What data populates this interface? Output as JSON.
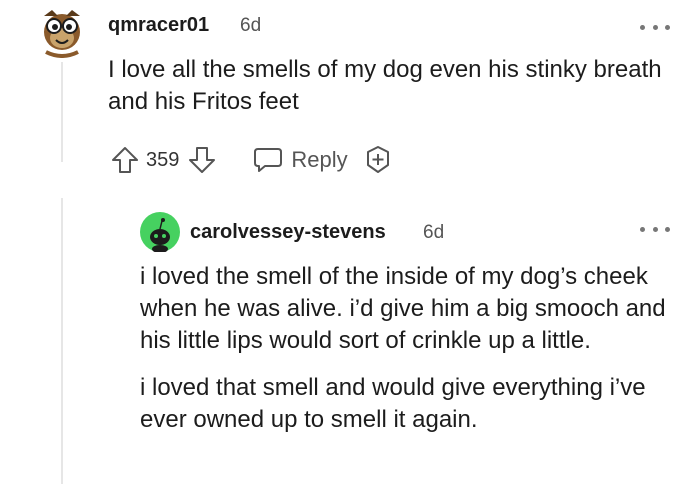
{
  "comment": {
    "username": "qmracer01",
    "age": "6d",
    "text": "I love all the smells of my dog even his stinky breath and his Fritos feet",
    "score": "359",
    "reply_label": "Reply"
  },
  "reply": {
    "username": "carolvessey-stevens",
    "age": "6d",
    "paragraphs": [
      "i loved the smell of the inside of my dog’s cheek when he was alive. i’d give him a big smooch and his little lips would sort of crinkle up a little.",
      "i loved that smell and would give everything i’ve ever owned up to smell it again."
    ]
  },
  "icons": {
    "avatar": "cartoon-avatar-icon",
    "snoo": "snoo-avatar-icon",
    "upvote": "upvote-arrow-icon",
    "downvote": "downvote-arrow-icon",
    "reply": "speech-bubble-icon",
    "award": "award-plus-icon",
    "more": "more-options-icon"
  },
  "colors": {
    "text": "#1c1c1c",
    "muted": "#555555",
    "snoo_bg": "#46d160",
    "thread": "#e6e6e6"
  }
}
